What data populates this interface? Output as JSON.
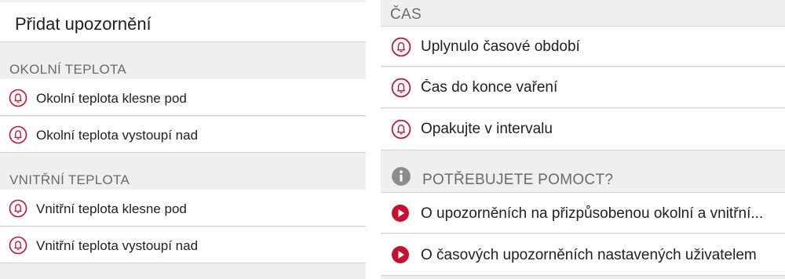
{
  "title": "Přidat upozornění",
  "colors": {
    "accent": "#c8102e",
    "info": "#8c8c8c"
  },
  "left": {
    "sections": [
      {
        "header": "OKOLNÍ TEPLOTA",
        "items": [
          "Okolní teplota klesne pod",
          "Okolní teplota vystoupí nad"
        ]
      },
      {
        "header": "VNITŘNÍ TEPLOTA",
        "items": [
          "Vnitřní teplota klesne pod",
          "Vnitřní teplota vystoupí nad"
        ]
      }
    ]
  },
  "right": {
    "time_section": {
      "header": "ČAS",
      "items": [
        "Uplynulo časové období",
        "Čas do konce vaření",
        "Opakujte v intervalu"
      ]
    },
    "help_section": {
      "header": "POTŘEBUJETE POMOCT?",
      "icon": "info-icon",
      "items": [
        "O upozorněních na přizpůsobenou okolní a vnitřní...",
        "O časových upozorněních nastavených uživatelem"
      ]
    }
  }
}
